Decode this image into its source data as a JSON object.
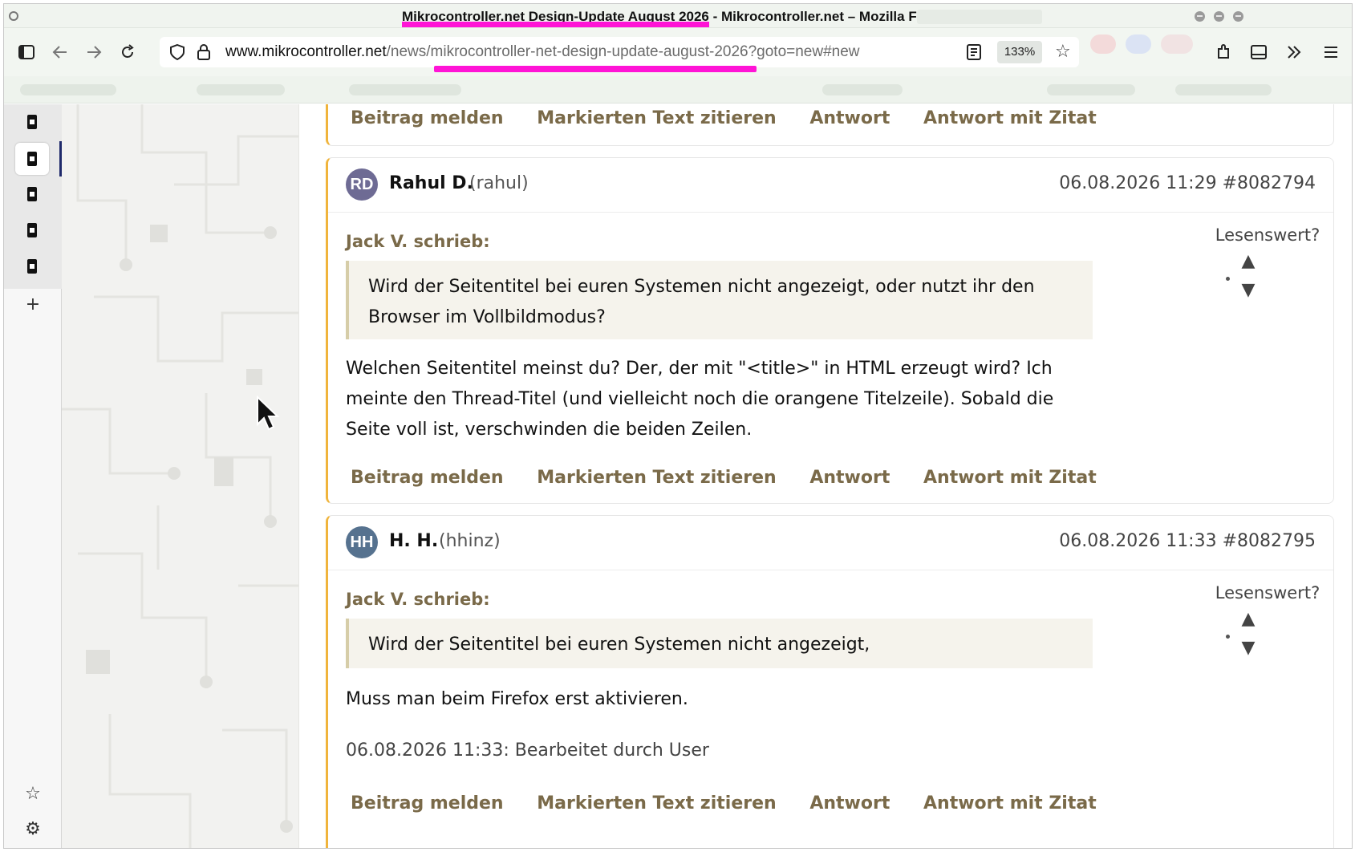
{
  "window": {
    "title_highlighted": "Mikrocontroller.net Design-Update August 2026",
    "title_rest": " - Mikrocontroller.net – Mozilla Firefox"
  },
  "toolbar": {
    "url_host": "www.mikrocontroller.net",
    "url_path": "/news/mikrocontroller-net-design-update-august-2026?goto=new#new",
    "zoom": "133%",
    "icons": [
      "sidebar-icon",
      "back-icon",
      "forward-icon",
      "reload-icon",
      "shield-icon",
      "lock-icon",
      "reader-view-icon",
      "bookmark-star-icon",
      "extensions-icon",
      "tab-overview-icon",
      "more-tools-icon",
      "menu-icon"
    ]
  },
  "sidebar": {
    "icons": [
      "new-tab-plus-icon",
      "star-icon",
      "gear-icon"
    ],
    "tab_count": 5,
    "active_tab": 2
  },
  "colors": {
    "post_accent": "#f0b43c",
    "link_brown": "#7a6a49",
    "highlight": "#ff14d6",
    "avatar_rd": "#6e6b94",
    "avatar_hh": "#56728f"
  },
  "actions": {
    "report": "Beitrag melden",
    "quote_selected": "Markierten Text zitieren",
    "reply": "Antwort",
    "reply_quote": "Antwort mit Zitat"
  },
  "posts": [
    {
      "initials": "RD",
      "author": "Rahul D.",
      "handle": "(rahul)",
      "meta": "06.08.2026 11:29  #8082794",
      "vote_label": "Lesenswert?",
      "quote_by": "Jack V. schrieb:",
      "quote": "Wird der Seitentitel bei euren Systemen nicht angezeigt, oder nutzt ihr den Browser im Vollbildmodus?",
      "body": "Welchen Seitentitel meinst du? Der, der mit \"<title>\" in HTML erzeugt wird? Ich meinte den Thread-Titel (und vielleicht noch die orangene Titelzeile). Sobald die Seite voll ist, verschwinden die beiden Zeilen."
    },
    {
      "initials": "HH",
      "author": "H. H.",
      "handle": "(hhinz)",
      "meta": "06.08.2026 11:33  #8082795",
      "vote_label": "Lesenswert?",
      "quote_by": "Jack V. schrieb:",
      "quote": "Wird der Seitentitel bei euren Systemen nicht angezeigt,",
      "body": "Muss man beim Firefox erst aktivieren.",
      "edited": "06.08.2026 11:33: Bearbeitet durch User"
    }
  ]
}
